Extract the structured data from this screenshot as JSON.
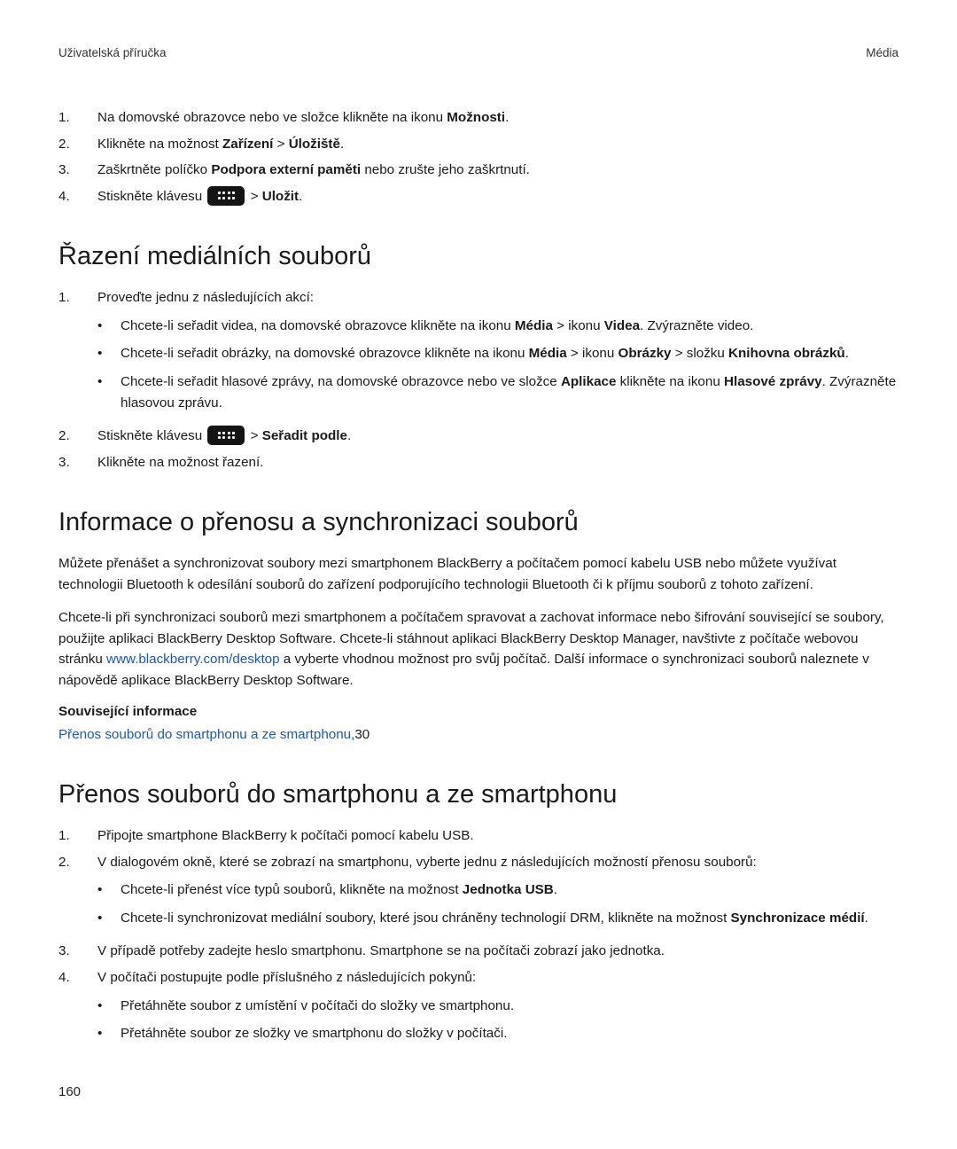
{
  "header": {
    "left": "Uživatelská příručka",
    "right": "Média"
  },
  "topList": {
    "1_pre": "Na domovské obrazovce nebo ve složce klikněte na ikonu ",
    "1_b": "Možnosti",
    "1_post": ".",
    "2_pre": "Klikněte na možnost ",
    "2_b1": "Zařízení",
    "2_mid": " > ",
    "2_b2": "Úložiště",
    "2_post": ".",
    "3_pre": "Zaškrtněte políčko ",
    "3_b": "Podpora externí paměti",
    "3_post": " nebo zrušte jeho zaškrtnutí.",
    "4_pre": "Stiskněte klávesu ",
    "4_mid": " > ",
    "4_b": "Uložit",
    "4_post": "."
  },
  "section1": {
    "title": "Řazení mediálních souborů",
    "li1": "Proveďte jednu z následujících akcí:",
    "b1_pre": "Chcete-li seřadit videa, na domovské obrazovce klikněte na ikonu ",
    "b1_b1": "Média",
    "b1_mid1": " > ikonu ",
    "b1_b2": "Videa",
    "b1_post": ". Zvýrazněte video.",
    "b2_pre": "Chcete-li seřadit obrázky, na domovské obrazovce klikněte na ikonu ",
    "b2_b1": "Média",
    "b2_mid1": " > ikonu ",
    "b2_b2": "Obrázky",
    "b2_mid2": " > složku ",
    "b2_b3": "Knihovna obrázků",
    "b2_post": ".",
    "b3_pre": "Chcete-li seřadit hlasové zprávy, na domovské obrazovce nebo ve složce ",
    "b3_b1": "Aplikace",
    "b3_mid": " klikněte na ikonu ",
    "b3_b2": "Hlasové zprávy",
    "b3_post": ". Zvýrazněte hlasovou zprávu.",
    "li2_pre": "Stiskněte klávesu ",
    "li2_mid": " > ",
    "li2_b": "Seřadit podle",
    "li2_post": ".",
    "li3": "Klikněte na možnost řazení."
  },
  "section2": {
    "title": "Informace o přenosu a synchronizaci souborů",
    "p1": "Můžete přenášet a synchronizovat soubory mezi smartphonem BlackBerry a počítačem pomocí kabelu USB nebo můžete využívat technologii Bluetooth k odesílání souborů do zařízení podporujícího technologii Bluetooth či k příjmu souborů z tohoto zařízení.",
    "p2_pre": "Chcete-li při synchronizaci souborů mezi smartphonem a počítačem spravovat a zachovat informace nebo šifrování související se soubory, použijte aplikaci BlackBerry Desktop Software. Chcete-li stáhnout aplikaci BlackBerry Desktop Manager, navštivte z počítače webovou stránku ",
    "p2_link": "www.blackberry.com/desktop",
    "p2_post": " a vyberte vhodnou možnost pro svůj počítač. Další informace o synchronizaci souborů naleznete v nápovědě aplikace BlackBerry Desktop Software.",
    "related_label": "Související informace",
    "related_link": "Přenos souborů do smartphonu a ze smartphonu,",
    "related_page": "30"
  },
  "section3": {
    "title": "Přenos souborů do smartphonu a ze smartphonu",
    "li1": "Připojte smartphone BlackBerry k počítači pomocí kabelu USB.",
    "li2": "V dialogovém okně, které se zobrazí na smartphonu, vyberte jednu z následujících možností přenosu souborů:",
    "li2_b1_pre": "Chcete-li přenést více typů souborů, klikněte na možnost ",
    "li2_b1_b": "Jednotka USB",
    "li2_b1_post": ".",
    "li2_b2_pre": "Chcete-li synchronizovat mediální soubory, které jsou chráněny technologií DRM, klikněte na možnost ",
    "li2_b2_b": "Synchronizace médií",
    "li2_b2_post": ".",
    "li3": "V případě potřeby zadejte heslo smartphonu. Smartphone se na počítači zobrazí jako jednotka.",
    "li4": "V počítači postupujte podle příslušného z následujících pokynů:",
    "li4_b1": "Přetáhněte soubor z umístění v počítači do složky ve smartphonu.",
    "li4_b2": "Přetáhněte soubor ze složky ve smartphonu do složky v počítači."
  },
  "pageNumber": "160",
  "nums": {
    "n1": "1.",
    "n2": "2.",
    "n3": "3.",
    "n4": "4."
  },
  "bullet": "•"
}
